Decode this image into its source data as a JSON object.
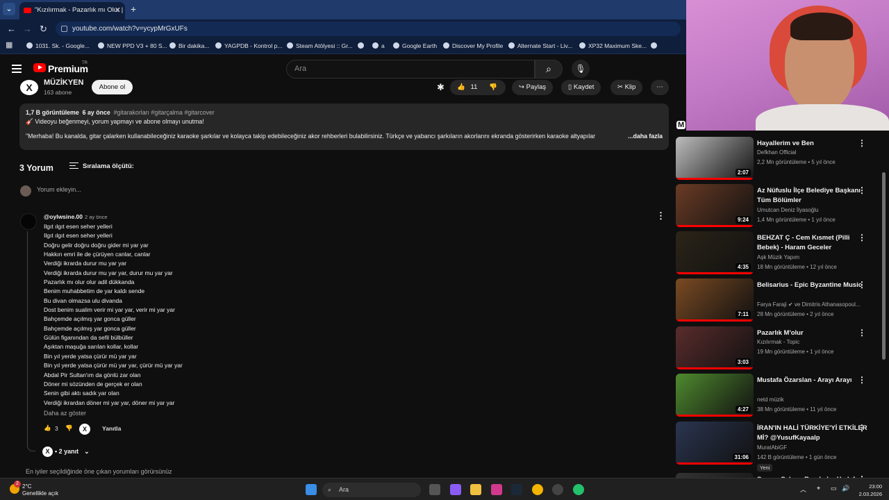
{
  "browser": {
    "tab_title": "\"Kızılırmak - Pazarlık mı Olur | K",
    "url": "youtube.com/watch?v=ycypMrGxUFs",
    "bookmarks": [
      "1031. Sk. - Google...",
      "NEW PPD V3 + 80 S...",
      "Bir dakika...",
      "YAGPDB - Kontrol p...",
      "Steam Atölyesi :: Gr...",
      "a",
      "Google Earth",
      "Discover My Profile",
      "Alternate Start - Liv...",
      "XP32 Maximum Ske..."
    ]
  },
  "header": {
    "logo_text": "Premium",
    "logo_tr": "TR",
    "search_placeholder": "Ara"
  },
  "channel": {
    "name": "MÜZİKYEN",
    "subs": "163 abone",
    "subscribe_label": "Abone ol",
    "like_count": "11",
    "share_label": "Paylaş",
    "save_label": "Kaydet",
    "clip_label": "Klip"
  },
  "description": {
    "views": "1,7 B görüntüleme",
    "age": "6 ay önce",
    "tags": "#gitarakorları #gitarçalma #gitarcover",
    "line1": "🎸 Videoyu beğenmeyi, yorum yapmayı ve abone olmayı unutma!",
    "line2": "\"Merhaba!  Bu kanalda, gitar çalarken kullanabileceğiniz karaoke şarkılar ve kolayca takip edebileceğiniz akor rehberleri bulabilirsiniz. Türkçe ve yabancı şarkıların akorlarını ekranda gösterirken karaoke altyapılar",
    "more": "...daha fazla"
  },
  "comments": {
    "count_label": "3 Yorum",
    "sort_label": "Sıralama ölçütü:",
    "add_placeholder": "Yorum ekleyin...",
    "author": "@oylwsine.00",
    "age": "2 ay önce",
    "lines": [
      "Ilgıt ılgıt esen seher yelleri",
      "Ilgıt ılgıt esen seher yelleri",
      "Doğru gelir doğru doğru gider mi yar yar",
      "Hakkın emri ile de çürüyen canlar, canlar",
      "Verdiği ikrarda durur mu yar yar",
      "Verdiği ikrarda durur mu yar yar, durur mu yar yar",
      "Pazarlık mı olur olur adil dükkanda",
      "Benim muhabbetim de yar kaldı sende",
      "Bu divan olmazsa ulu divanda",
      "Dost benim sualim verir mi yar yar, verir mi yar yar",
      "Bahçemde açılmış yar gonca güller",
      "Bahçemde açılmış yar gonca güller",
      "Gülün figanından da sefil bülbüller",
      "Aşıktan maşuğa sarılan kollar, kollar",
      "Bin yıl yerde yatsa çürür mü yar yar",
      "Bin yıl yerde yatsa çürür mü yar yar, çürür mü yar yar",
      "Abdal Pir Sultan'ım da gönlü zar olan",
      "Döner mi sözünden de gerçek er olan",
      "Senin gibi aktı sadık yar olan",
      "Verdiği ikrardan döner mi yar yar, döner mi yar yar"
    ],
    "show_less": "Daha az göster",
    "like_count": "3",
    "reply_label": "Yanıtla",
    "replies_label": "• 2 yanıt",
    "bottom_note": "En iyiler seçildiğinde öne çıkan yorumları görürsünüz"
  },
  "related": [
    {
      "title": "Hayallerim ve Ben",
      "channel": "Defkhan Official",
      "meta": "2,2 Mn görüntüleme • 5 yıl önce",
      "duration": "2:07",
      "color": "#bdbdbd"
    },
    {
      "title": "Az Nüfuslu İlçe Belediye Başkanı Tüm Bölümler",
      "channel": "Umutcan Deniz İlyasoğlu",
      "meta": "1,4 Mn görüntüleme • 1 yıl önce",
      "duration": "9:24",
      "color": "#6a3b25"
    },
    {
      "title": "BEHZAT Ç - Cem Kısmet (Pilli Bebek) - Haram Geceler",
      "channel": "Aşk Müzik Yapım",
      "meta": "18 Mn görüntüleme • 12 yıl önce",
      "duration": "4:35",
      "color": "#2b2418"
    },
    {
      "title": "Belisarius - Epic Byzantine Music",
      "channel": "Farya Faraji ✔ ve Dimitris Athanasopoul...",
      "meta": "28 Mn görüntüleme • 2 yıl önce",
      "duration": "7:11",
      "color": "#7a4a22"
    },
    {
      "title": "Pazarlık M'olur",
      "channel": "Kızılırmak - Topic",
      "meta": "19 Mn görüntüleme • 1 yıl önce",
      "duration": "3:03",
      "color": "#5a2c2c"
    },
    {
      "title": "Mustafa Özarslan - Arayı Arayı",
      "channel": "netd müzik",
      "meta": "38 Mn görüntüleme • 11 yıl önce",
      "duration": "4:27",
      "color": "#4f8a2e"
    },
    {
      "title": "İRAN'IN HALİ TÜRKİYE'Yİ ETKİLER Mİ? @YusufKayaalp",
      "channel": "MuratAbiGF",
      "meta": "142 B görüntüleme • 1 gün önce",
      "duration": "31:06",
      "color": "#2a3550",
      "badge": "Yeni"
    },
    {
      "title": "Sansar Salvo - Bombalar Hedef",
      "channel": "",
      "meta": "",
      "duration": "",
      "color": "#333333"
    }
  ],
  "taskbar": {
    "temp": "2°C",
    "weather": "Genellikle açık",
    "notif": "2",
    "search": "Ara",
    "time": "23:00",
    "date": "2.03.2026"
  }
}
